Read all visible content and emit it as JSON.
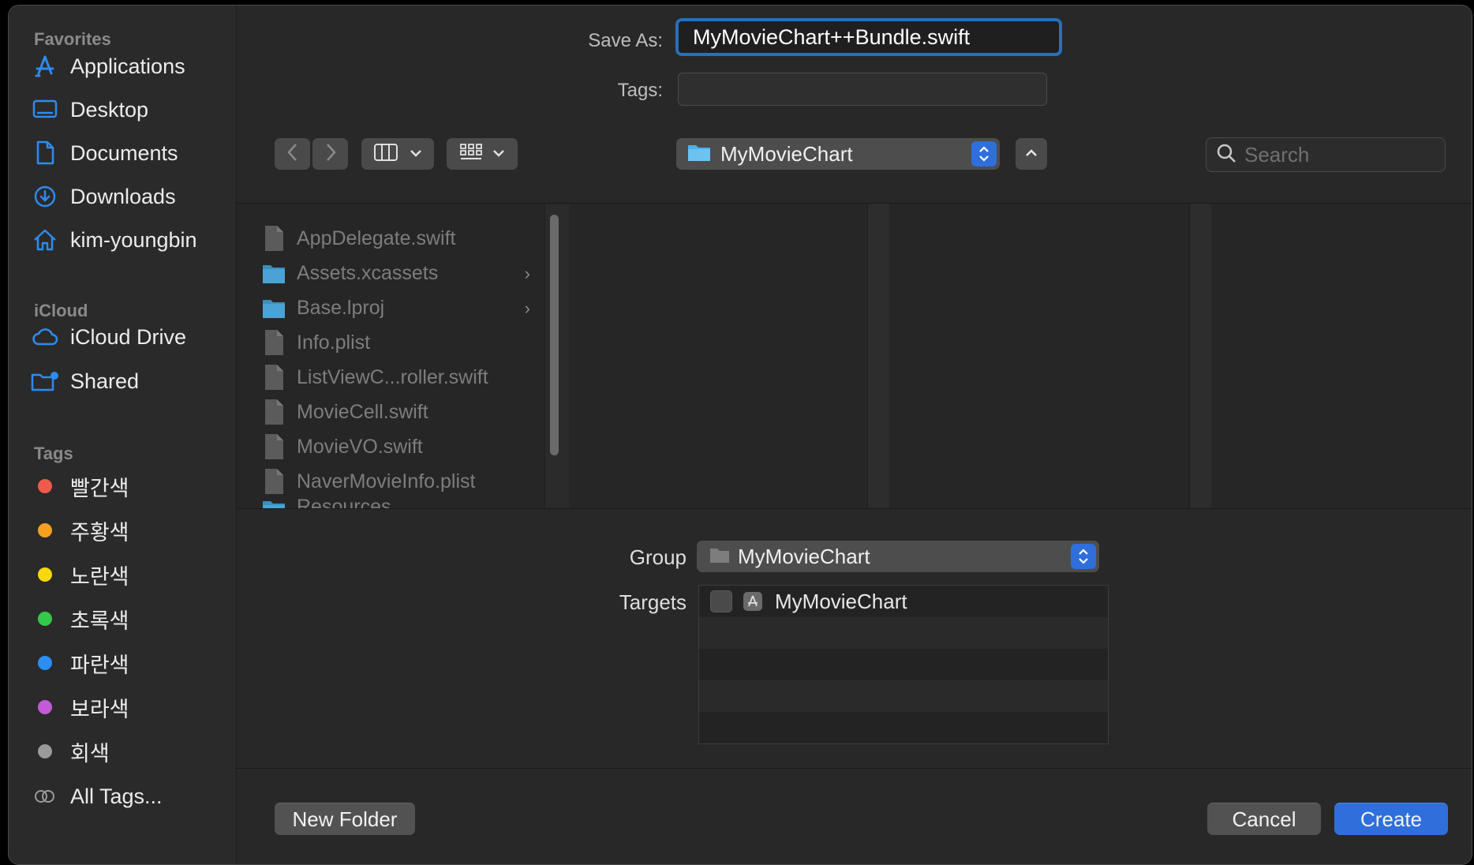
{
  "sidebar": {
    "favorites_title": "Favorites",
    "favorites": [
      {
        "label": "Applications",
        "icon": "applications-icon"
      },
      {
        "label": "Desktop",
        "icon": "desktop-icon"
      },
      {
        "label": "Documents",
        "icon": "document-icon"
      },
      {
        "label": "Downloads",
        "icon": "download-icon"
      },
      {
        "label": "kim-youngbin",
        "icon": "home-icon"
      }
    ],
    "icloud_title": "iCloud",
    "icloud": [
      {
        "label": "iCloud Drive",
        "icon": "cloud-icon"
      },
      {
        "label": "Shared",
        "icon": "shared-folder-icon"
      }
    ],
    "tags_title": "Tags",
    "tags": [
      {
        "label": "빨간색",
        "color": "#f05a4b"
      },
      {
        "label": "주황색",
        "color": "#f6a021"
      },
      {
        "label": "노란색",
        "color": "#f5d90a"
      },
      {
        "label": "초록색",
        "color": "#35c84b"
      },
      {
        "label": "파란색",
        "color": "#2a8ef4"
      },
      {
        "label": "보라색",
        "color": "#c35ad7"
      },
      {
        "label": "회색",
        "color": "#9a9a9a"
      }
    ],
    "all_tags": "All Tags..."
  },
  "header": {
    "save_as_label": "Save As:",
    "save_as_value": "MyMovieChart++Bundle.swift",
    "tags_label": "Tags:",
    "location": "MyMovieChart",
    "search_placeholder": "Search"
  },
  "browser": {
    "files": [
      {
        "name": "AppDelegate.swift",
        "type": "swift",
        "folder": false
      },
      {
        "name": "Assets.xcassets",
        "type": "folder",
        "folder": true
      },
      {
        "name": "Base.lproj",
        "type": "folder",
        "folder": true
      },
      {
        "name": "Info.plist",
        "type": "plist",
        "folder": false
      },
      {
        "name": "ListViewC...roller.swift",
        "type": "swift",
        "folder": false
      },
      {
        "name": "MovieCell.swift",
        "type": "swift",
        "folder": false
      },
      {
        "name": "MovieVO.swift",
        "type": "swift",
        "folder": false
      },
      {
        "name": "NaverMovieInfo.plist",
        "type": "plist",
        "folder": false
      },
      {
        "name": "Resources",
        "type": "folder",
        "folder": true
      }
    ]
  },
  "options": {
    "group_label": "Group",
    "group_value": "MyMovieChart",
    "targets_label": "Targets",
    "targets": [
      {
        "name": "MyMovieChart",
        "checked": false
      }
    ]
  },
  "footer": {
    "new_folder": "New Folder",
    "cancel": "Cancel",
    "create": "Create"
  }
}
